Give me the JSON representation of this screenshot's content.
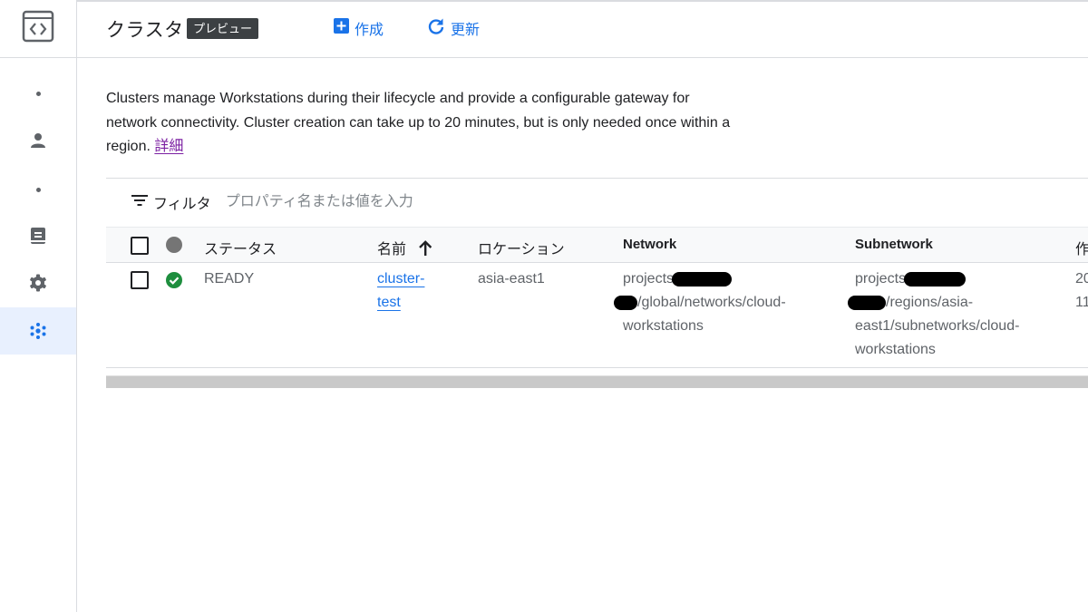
{
  "header": {
    "title": "クラスタ",
    "badge": "プレビュー",
    "create_label": "作成",
    "refresh_label": "更新"
  },
  "description": {
    "text": "Clusters manage Workstations during their lifecycle and provide a configurable gateway for network connectivity. Cluster creation can take up to 20 minutes, but is only needed once within a region. ",
    "link": "詳細"
  },
  "filter": {
    "label": "フィルタ",
    "placeholder": "プロパティ名または値を入力"
  },
  "table": {
    "columns": {
      "status": "ステータス",
      "name": "名前",
      "location": "ロケーション",
      "network": "Network",
      "subnetwork": "Subnetwork",
      "created": "作"
    },
    "rows": [
      {
        "status": "READY",
        "name_line1": "cluster-",
        "name_line2": "test",
        "location": "asia-east1",
        "network_line1": "projects",
        "network_line2": "/global/networks/cloud-",
        "network_line3": "workstations",
        "subnetwork_line1": "projects",
        "subnetwork_line2": "/regions/asia-",
        "subnetwork_line3": "east1/subnetworks/cloud-",
        "subnetwork_line4": "workstations",
        "created_line1": "20",
        "created_line2": "11"
      }
    ]
  },
  "icons": {
    "rail_logo": "workstations-code-icon",
    "rail_user": "person-icon",
    "rail_config": "badge-icon",
    "rail_settings": "gear-icon",
    "rail_clusters": "clusters-icon"
  },
  "colors": {
    "accent": "#1a73e8",
    "status_ready": "#1e8e3e",
    "link_visited": "#7b1fa2",
    "active_nav_bg": "#e8f0fe"
  }
}
